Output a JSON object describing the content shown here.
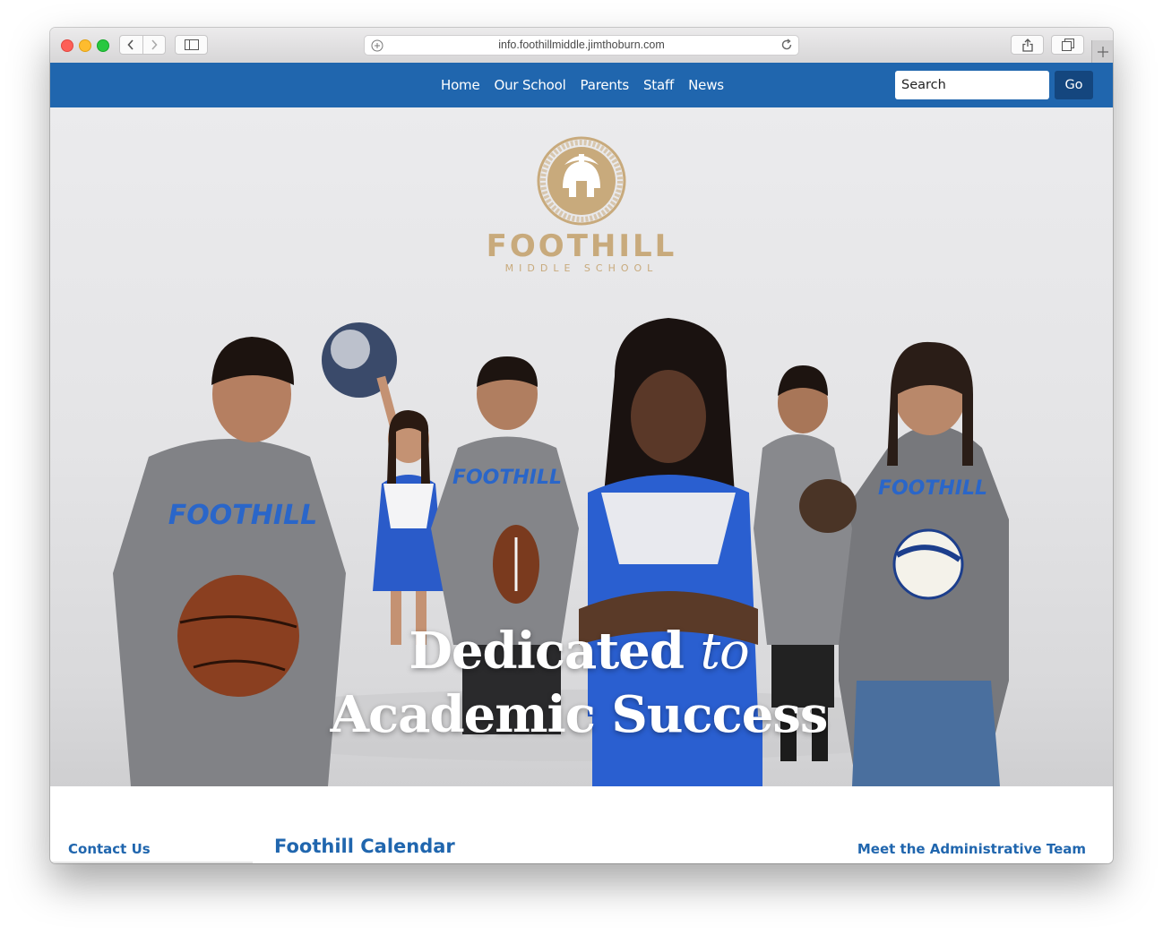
{
  "browser": {
    "url": "info.foothillmiddle.jimthoburn.com"
  },
  "nav": {
    "items": [
      "Home",
      "Our School",
      "Parents",
      "Staff",
      "News"
    ],
    "search_placeholder": "Search",
    "go_label": "Go"
  },
  "hero": {
    "logo_word": "FOOTHILL",
    "logo_sub": "MIDDLE SCHOOL",
    "logo_ring_text": "RESPECTFUL · RESPONSIBLE · SAFE",
    "tagline_line1_main": "Dedicated",
    "tagline_line1_em": "to",
    "tagline_line2": "Academic Success"
  },
  "sections": {
    "contact": "Contact Us",
    "calendar": "Foothill Calendar",
    "admin": "Meet the Administrative Team"
  },
  "colors": {
    "nav_blue": "#2066ae",
    "button_dark_blue": "#14467e",
    "logo_gold": "#c8aa7c"
  }
}
